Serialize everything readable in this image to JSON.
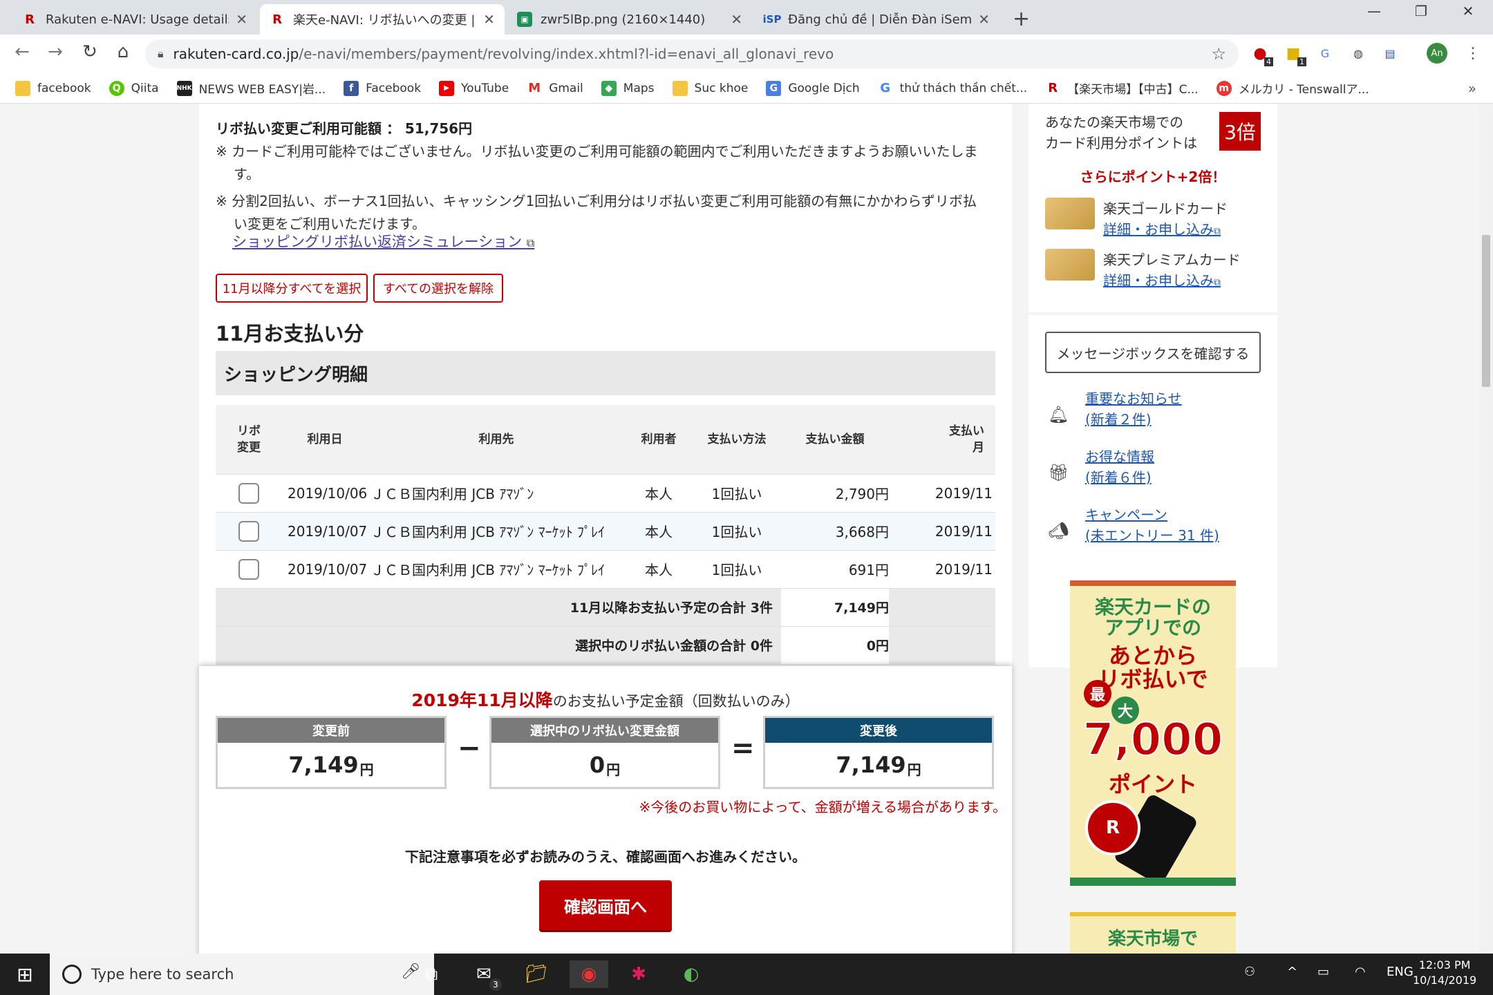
{
  "browser": {
    "tabs": [
      {
        "title": "Rakuten e-NAVI: Usage details",
        "favicon": "R",
        "active": false
      },
      {
        "title": "楽天e-NAVI: リボ払いへの変更 | お",
        "favicon": "R",
        "active": true
      },
      {
        "title": "zwr5lBp.png (2160×1440)",
        "favicon": "img",
        "active": false
      },
      {
        "title": "Đăng chủ đề | Diễn Đàn iSemPai",
        "favicon": "iSP",
        "active": false
      }
    ],
    "url_host": "rakuten-card.co.jp",
    "url_path": "/e-navi/members/payment/revolving/index.xhtml?l-id=enavi_all_glonavi_revo",
    "profile_initials": "An",
    "ext_badges": {
      "red": "4",
      "yellow": "1"
    },
    "bookmarks": [
      {
        "label": "facebook",
        "icon": "folder-icon"
      },
      {
        "label": "Qiita",
        "icon": "qiita-icon"
      },
      {
        "label": "NEWS WEB EASY|岩...",
        "icon": "nhk-icon"
      },
      {
        "label": "Facebook",
        "icon": "facebook-icon"
      },
      {
        "label": "YouTube",
        "icon": "youtube-icon"
      },
      {
        "label": "Gmail",
        "icon": "gmail-icon"
      },
      {
        "label": "Maps",
        "icon": "maps-icon"
      },
      {
        "label": "Suc khoe",
        "icon": "folder-icon"
      },
      {
        "label": "Google Dịch",
        "icon": "translate-icon"
      },
      {
        "label": "thử thách thần chết...",
        "icon": "google-icon"
      },
      {
        "label": "【楽天市場】【中古】C...",
        "icon": "rakuten-icon"
      },
      {
        "label": "メルカリ - Tenswallア...",
        "icon": "mercari-icon"
      }
    ]
  },
  "page": {
    "available_label": "リボ払い変更ご利用可能額 ： 51,756円",
    "note1": "※ カードご利用可能枠ではございません。リボ払い変更のご利用可能額の範囲内でご利用いただきますようお願いいたします。",
    "note2": "※ 分割2回払い、ボーナス1回払い、キャッシング1回払いご利用分はリボ払い変更ご利用可能額の有無にかかわらずリボ払い変更をご利用いただけます。",
    "sim_link": "ショッピングリボ払い返済シミュレーション",
    "select_all_btn": "11月以降分すべてを選択",
    "clear_all_btn": "すべての選択を解除",
    "section_title": "11月お支払い分",
    "subheading": "ショッピング明細",
    "table": {
      "headers": [
        "リボ\n変更",
        "利用日",
        "利用先",
        "利用者",
        "支払い方法",
        "支払い金額",
        "支払い\n月"
      ],
      "rows": [
        {
          "date": "2019/10/06",
          "merchant": "ＪＣＢ国内利用 JCB ｱﾏｿﾞﾝ",
          "user": "本人",
          "method": "1回払い",
          "amount": "2,790円",
          "month": "2019/11"
        },
        {
          "date": "2019/10/07",
          "merchant": "ＪＣＢ国内利用 JCB ｱﾏｿﾞﾝ ﾏｰｹｯﾄ ﾌﾟﾚｲ",
          "user": "本人",
          "method": "1回払い",
          "amount": "3,668円",
          "month": "2019/11"
        },
        {
          "date": "2019/10/07",
          "merchant": "ＪＣＢ国内利用 JCB ｱﾏｿﾞﾝ ﾏｰｹｯﾄ ﾌﾟﾚｲ",
          "user": "本人",
          "method": "1回払い",
          "amount": "691円",
          "month": "2019/11"
        }
      ],
      "total_label": "11月以降お支払い予定の合計 3件",
      "total_value": "7,149円",
      "selected_label": "選択中のリボ払い金額の合計 0件",
      "selected_value": "0円"
    },
    "summary": {
      "title_highlight": "2019年11月以降",
      "title_rest": "のお支払い予定金額（回数払いのみ）",
      "before_label": "変更前",
      "before_value": "7,149",
      "selected_label": "選択中のリボ払い変更金額",
      "selected_value": "0",
      "after_label": "変更後",
      "after_value": "7,149",
      "yen": "円",
      "minus": "−",
      "equals": "=",
      "note": "※今後のお買い物によって、金額が増える場合があります。",
      "instruction": "下記注意事項を必ずお読みのうえ、確認画面へお進みください。",
      "confirm_btn": "確認画面へ"
    }
  },
  "sidebar": {
    "points_line1": "あなたの楽天市場での",
    "points_line2": "カード利用分ポイントは",
    "points_badge": "3倍",
    "points_more": "さらにポイント+2倍！",
    "cards": [
      {
        "name": "楽天ゴールドカード",
        "link": "詳細・お申し込み"
      },
      {
        "name": "楽天プレミアムカード",
        "link": "詳細・お申し込み"
      }
    ],
    "message_btn": "メッセージボックスを確認する",
    "links": [
      {
        "line1": "重要なお知らせ",
        "line2": "(新着２件)",
        "icon": "bell-icon"
      },
      {
        "line1": "お得な情報",
        "line2": "(新着６件)",
        "icon": "gift-icon"
      },
      {
        "line1": "キャンペーン",
        "line2": "(未エントリー 31 件)",
        "icon": "megaphone-icon"
      }
    ],
    "banner": {
      "line1": "楽天カードの",
      "line1b": "アプリでの",
      "line2": "あとから",
      "line2b": "リボ払いで",
      "tag1": "最",
      "tag2": "大",
      "big": "7,000",
      "unit": "ポイント"
    },
    "banner2": "楽天市場で"
  },
  "taskbar": {
    "search_placeholder": "Type here to search",
    "mail_badge": "3",
    "lang": "ENG",
    "time": "12:03 PM",
    "date": "10/14/2019"
  },
  "colors": {
    "brand": "#bf0000",
    "after_header": "#0f4c6e",
    "before_header": "#7a7a7a"
  }
}
